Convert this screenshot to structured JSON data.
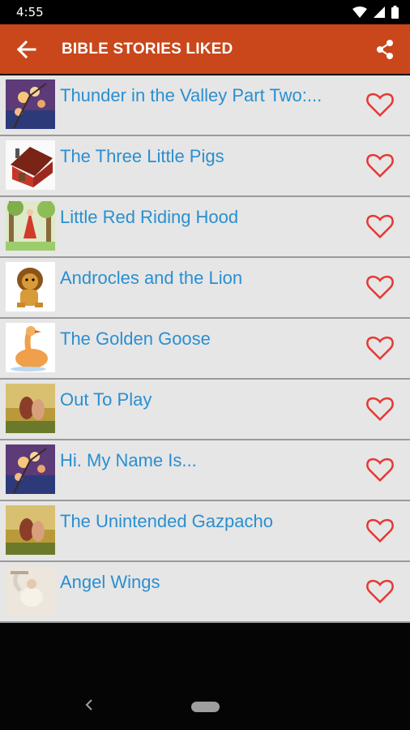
{
  "status_bar": {
    "time": "4:55"
  },
  "app_bar": {
    "title": "BIBLE STORIES LIKED",
    "back_icon": "arrow-left-icon",
    "share_icon": "share-icon",
    "color": "#c9471b"
  },
  "stories": [
    {
      "title": "Thunder in the Valley Part Two:...",
      "thumb": "flowers"
    },
    {
      "title": "The Three Little Pigs",
      "thumb": "house"
    },
    {
      "title": "Little Red Riding Hood",
      "thumb": "forest"
    },
    {
      "title": "Androcles and the Lion",
      "thumb": "lion"
    },
    {
      "title": "The Golden Goose",
      "thumb": "goose"
    },
    {
      "title": "Out To Play",
      "thumb": "couple"
    },
    {
      "title": "Hi. My Name Is...",
      "thumb": "flowers"
    },
    {
      "title": "The Unintended Gazpacho",
      "thumb": "couple"
    },
    {
      "title": "Angel Wings",
      "thumb": "angel"
    }
  ],
  "colors": {
    "title_text": "#2a8fd1",
    "heart": "#e53935"
  }
}
